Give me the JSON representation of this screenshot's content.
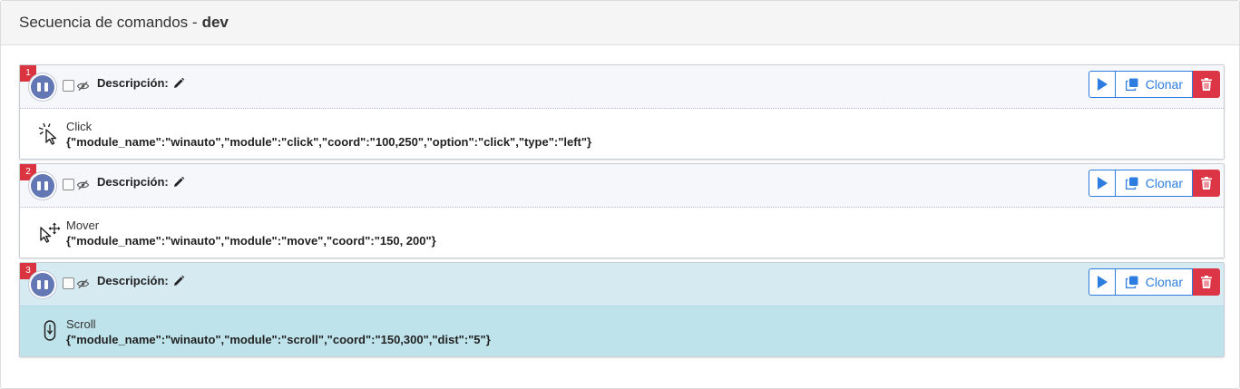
{
  "header": {
    "title_prefix": "Secuencia de comandos -",
    "title_env": "dev"
  },
  "colors": {
    "badge": "#d9343f",
    "primary": "#2d7de0",
    "danger": "#dc3545",
    "active_head": "#d6eaf2",
    "active_body": "#bfe3eb"
  },
  "steps": [
    {
      "number": "1",
      "description_label": "Descripción:",
      "clone_label": "Clonar",
      "command_name": "Click",
      "command_icon": "mouse-click-icon",
      "command_json": "{\"module_name\":\"winauto\",\"module\":\"click\",\"coord\":\"100,250\",\"option\":\"click\",\"type\":\"left\"}",
      "active": false
    },
    {
      "number": "2",
      "description_label": "Descripción:",
      "clone_label": "Clonar",
      "command_name": "Mover",
      "command_icon": "mouse-move-icon",
      "command_json": "{\"module_name\":\"winauto\",\"module\":\"move\",\"coord\":\"150, 200\"}",
      "active": false
    },
    {
      "number": "3",
      "description_label": "Descripción:",
      "clone_label": "Clonar",
      "command_name": "Scroll",
      "command_icon": "mouse-scroll-icon",
      "command_json": "{\"module_name\":\"winauto\",\"module\":\"scroll\",\"coord\":\"150,300\",\"dist\":\"5\"}",
      "active": true
    }
  ]
}
